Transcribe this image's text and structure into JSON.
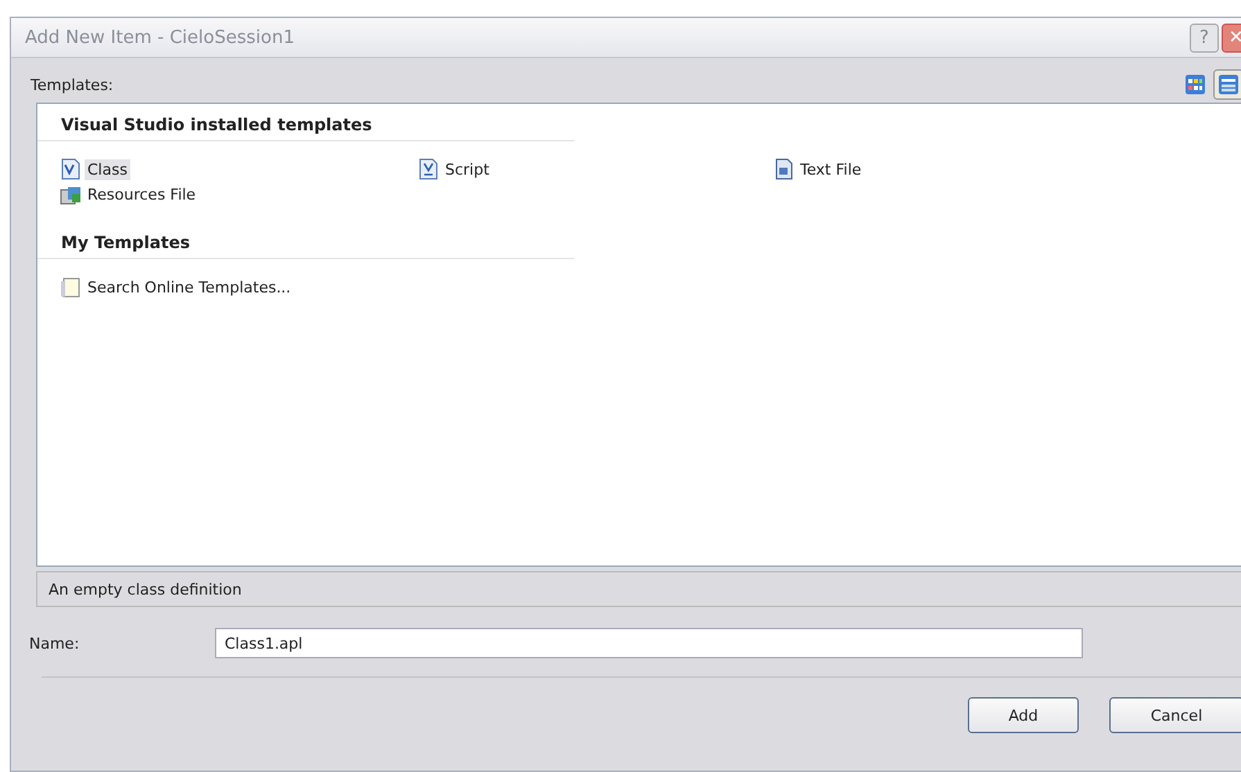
{
  "window": {
    "title": "Add New Item - CieloSession1",
    "buttons": [
      {
        "kind": "help",
        "label": "?"
      },
      {
        "kind": "close",
        "label": "✕"
      }
    ]
  },
  "templates_label": "Templates:",
  "view_buttons": [
    {
      "kind": "large-icons",
      "selected": false
    },
    {
      "kind": "small-icons",
      "selected": true
    }
  ],
  "groups": [
    {
      "heading": "Visual Studio installed templates",
      "items": [
        {
          "kind": "class",
          "label": "Class",
          "selected": true
        },
        {
          "kind": "script",
          "label": "Script",
          "selected": false
        },
        {
          "kind": "text",
          "label": "Text File",
          "selected": false
        },
        {
          "kind": "resources",
          "label": "Resources File",
          "selected": false
        }
      ]
    },
    {
      "heading": "My Templates",
      "items": [
        {
          "kind": "search",
          "label": "Search Online Templates...",
          "selected": false
        }
      ]
    }
  ],
  "description": "An empty class definition",
  "name_field": {
    "label": "Name:",
    "value": "Class1.apl"
  },
  "buttons": [
    "Add",
    "Cancel"
  ]
}
